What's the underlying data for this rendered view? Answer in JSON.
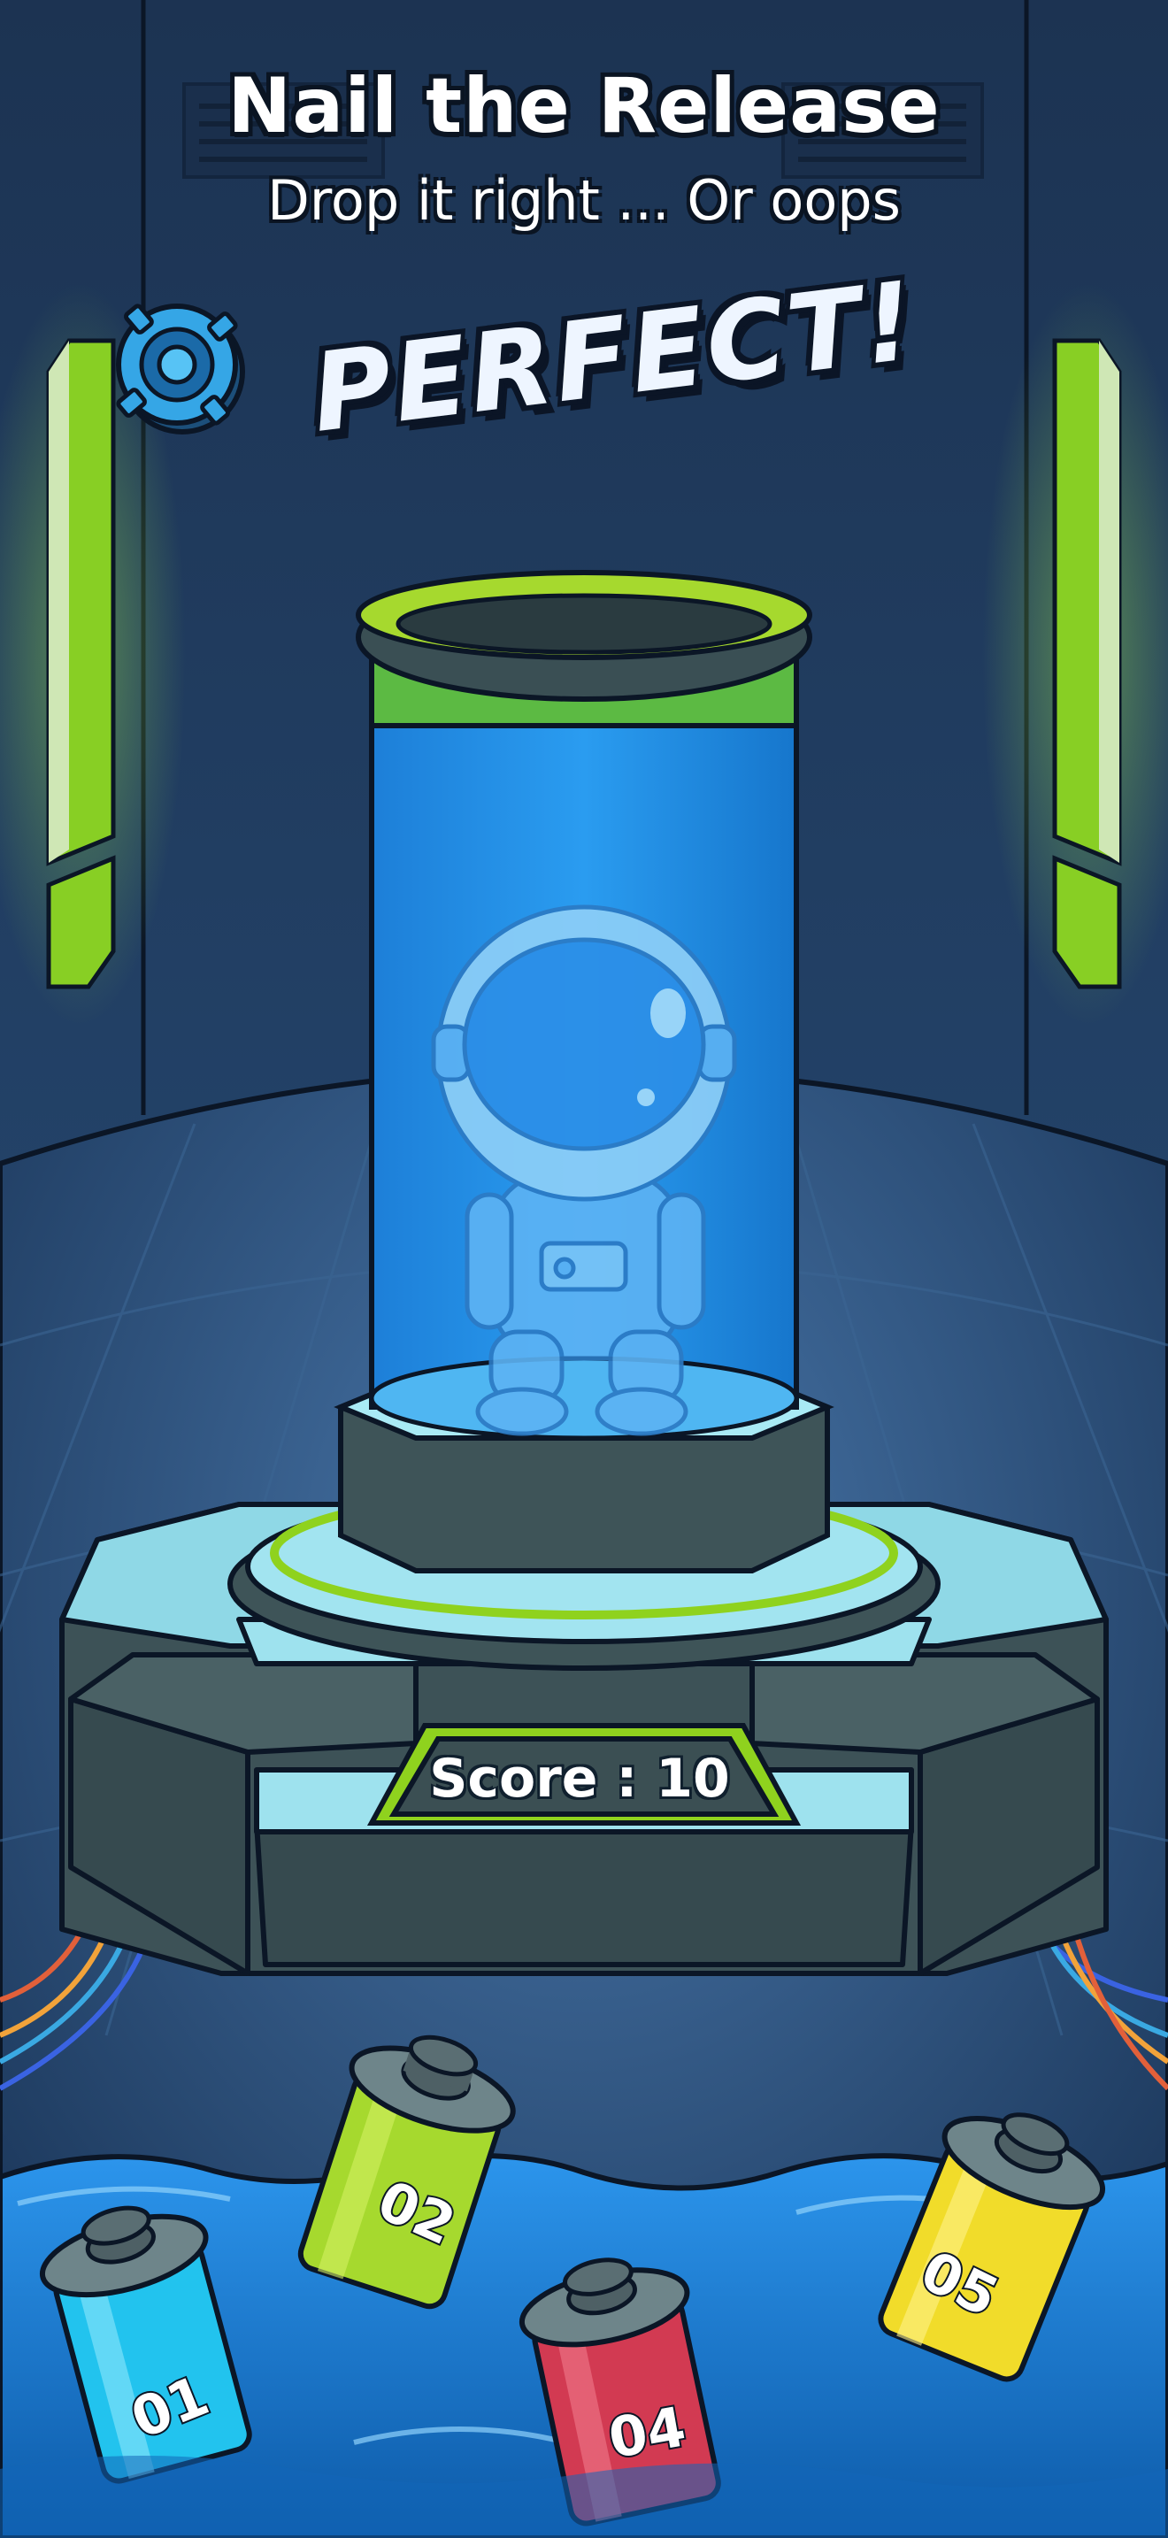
{
  "header": {
    "title": "Nail the Release",
    "subtitle": "Drop it right ... Or oops"
  },
  "feedback": {
    "label": "PERFECT!",
    "icon": "target-icon"
  },
  "hud": {
    "score_text": "Score : 10"
  },
  "barrels": [
    {
      "label": "01",
      "color": "#22c3ee"
    },
    {
      "label": "02",
      "color": "#a6d92e"
    },
    {
      "label": "04",
      "color": "#d23a52"
    },
    {
      "label": "05",
      "color": "#f1dc2a"
    }
  ],
  "colors": {
    "background": "#1c3556",
    "floor": "#2a4a72",
    "water": "#1877c9",
    "accent_green": "#8fd21e",
    "tube_liquid": "#1e8fe0",
    "platform": "#9ee2ee"
  }
}
